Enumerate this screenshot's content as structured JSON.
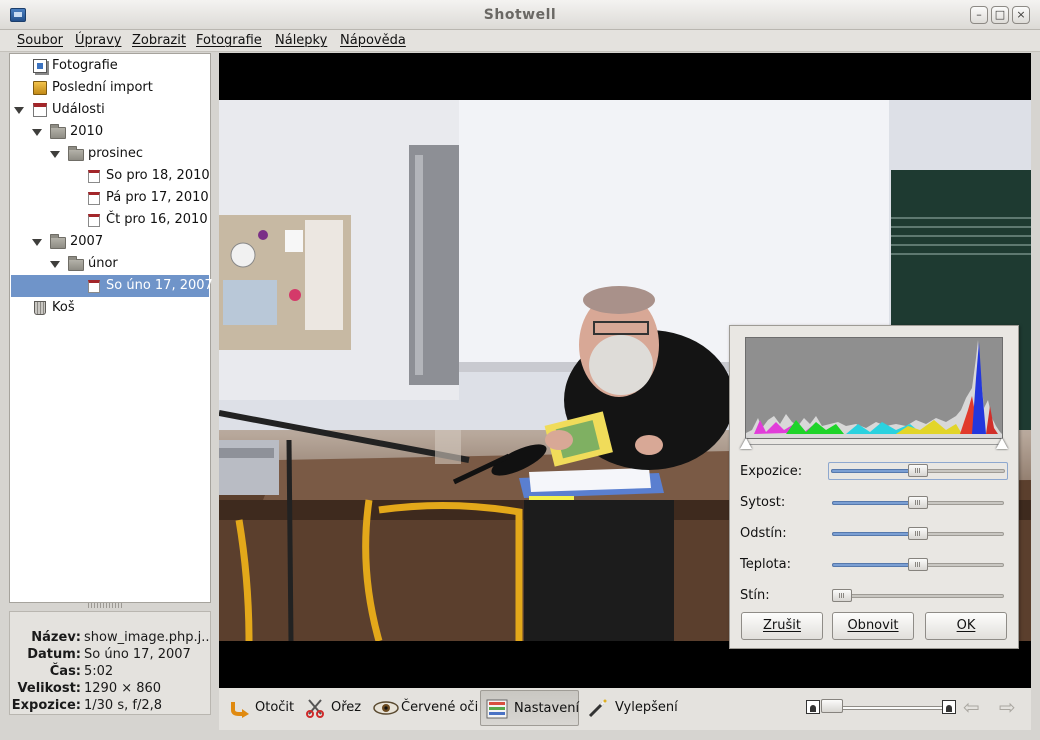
{
  "window": {
    "title": "Shotwell",
    "controls": {
      "minimize": "–",
      "maximize": "□",
      "close": "×"
    }
  },
  "menubar": {
    "items": [
      "Soubor",
      "Úpravy",
      "Zobrazit",
      "Fotografie",
      "Nálepky",
      "Nápověda"
    ]
  },
  "sidebar": {
    "photos": "Fotografie",
    "last_import": "Poslední import",
    "events": "Události",
    "years": [
      {
        "label": "2010",
        "months": [
          {
            "label": "prosinec",
            "days": [
              "So pro 18, 2010",
              "Pá pro 17, 2010",
              "Čt pro 16, 2010"
            ]
          }
        ]
      },
      {
        "label": "2007",
        "months": [
          {
            "label": "únor",
            "days": [
              "So úno 17, 2007"
            ]
          }
        ]
      }
    ],
    "selected": "So úno 17, 2007",
    "trash": "Koš"
  },
  "info": {
    "name_key": "Název:",
    "name_val": "show_image.php.j...",
    "date_key": "Datum:",
    "date_val": "So úno 17, 2007",
    "time_key": "Čas:",
    "time_val": "5:02",
    "size_key": "Velikost:",
    "size_val": "1290 × 860",
    "exposure_key": "Expozice:",
    "exposure_val": "1/30 s, f/2,8"
  },
  "adjust": {
    "labels": {
      "exposure": "Expozice:",
      "saturation": "Sytost:",
      "tint": "Odstín:",
      "temperature": "Teplota:",
      "shadows": "Stín:"
    },
    "levels": {
      "exposure": 0.5,
      "saturation": 0.5,
      "tint": 0.5,
      "temperature": 0.5,
      "shadows": 0.0
    },
    "buttons": {
      "cancel": "Zrušit",
      "reset": "Obnovit",
      "ok": "OK"
    }
  },
  "toolbar": {
    "rotate": "Otočit",
    "crop": "Ořez",
    "redeye": "Červené oči",
    "adjust": "Nastavení",
    "enhance": "Vylepšení",
    "zoom_level": 0.0
  },
  "colors": {
    "selection": "#6f94c9",
    "slider_fill": "#7b9fd3",
    "viewer_bg": "#000000"
  }
}
